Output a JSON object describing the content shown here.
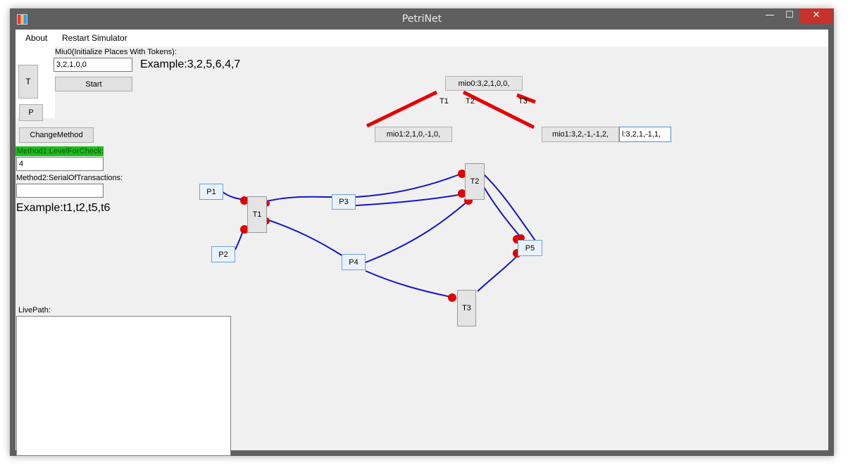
{
  "window": {
    "title": "PetriNet",
    "minimize_glyph": "—",
    "maximize_glyph": "☐",
    "close_glyph": "✕"
  },
  "menu": {
    "about": "About",
    "restart": "Restart Simulator"
  },
  "toolbox": {
    "t_button": "T",
    "p_button": "P"
  },
  "init": {
    "label": "Miu0(Initialize Places With Tokens):",
    "value": "3,2,1,0,0",
    "example": "Example:3,2,5,6,4,7",
    "start_button": "Start"
  },
  "method": {
    "change_button": "ChangeMethod",
    "method1_label": "Method1:LevelForCheck:",
    "method1_value": "4",
    "method2_label": "Method2:SerialOfTransactions:",
    "method2_value": "",
    "example": "Example:t1,t2,t5,t6"
  },
  "livepath": {
    "label": "LivePath:"
  },
  "tree": {
    "root": "mio0:3,2,1,0,0,",
    "edge_labels": [
      "T1",
      "T2",
      "T3"
    ],
    "child1": "mio1:2,1,0,-1,0,",
    "child2": "mio1:3,2,-1,-1,2,",
    "child3": "l:3,2,1,-1,1,"
  },
  "net": {
    "places": [
      "P1",
      "P2",
      "P3",
      "P4",
      "P5"
    ],
    "transitions": [
      "T1",
      "T2",
      "T3"
    ]
  },
  "colors": {
    "arc": "#1414c8",
    "port": "#e00000",
    "tree_edge": "#e60000",
    "close": "#c7312b",
    "highlight": "#1fbb1f"
  }
}
